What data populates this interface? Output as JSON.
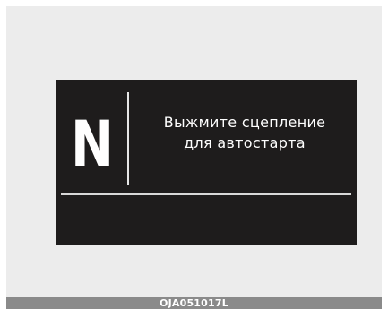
{
  "display": {
    "gear": "N",
    "message_line1": "Выжмите сцепление",
    "message_line2": "для автостарта"
  },
  "caption": {
    "code": "OJA051017L"
  },
  "colors": {
    "background": "#ececec",
    "screen": "#1e1c1c",
    "text": "#ffffff",
    "caption_bar": "#8a8a8a"
  }
}
